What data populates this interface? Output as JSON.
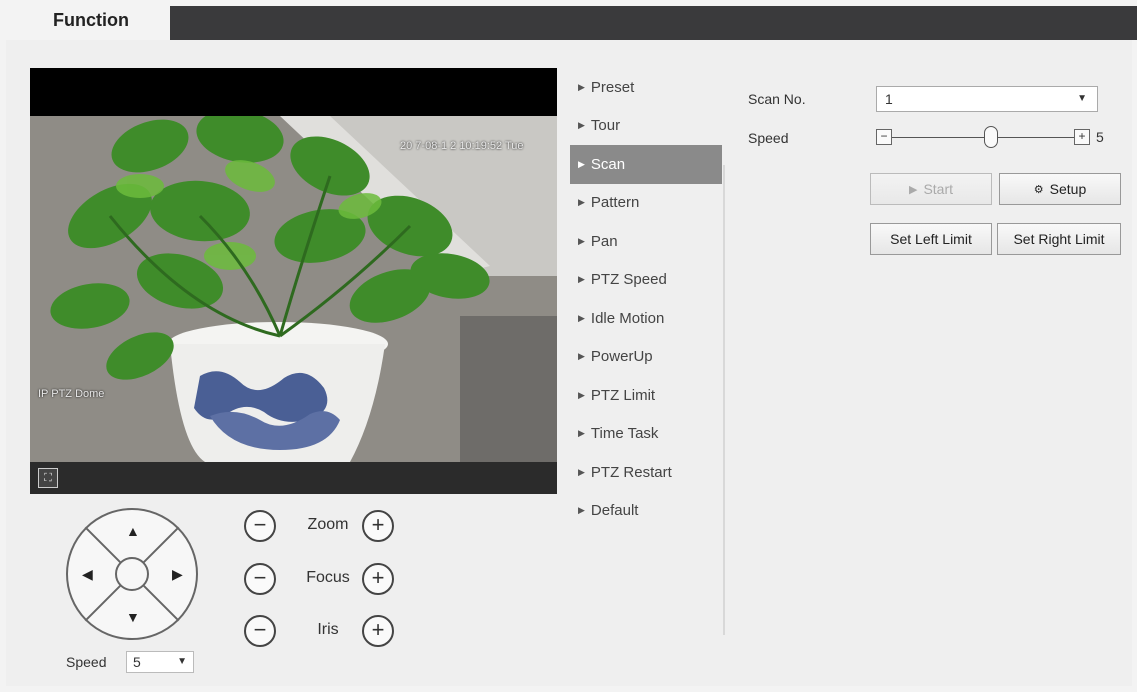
{
  "tab": {
    "label": "Function"
  },
  "video": {
    "timestamp": "20 7-08-1 2 10:19:52 Tue",
    "camera_name": "IP PTZ Dome",
    "fullscreen_icon": "fullscreen-icon"
  },
  "ptz": {
    "zoom_label": "Zoom",
    "focus_label": "Focus",
    "iris_label": "Iris",
    "speed_label": "Speed",
    "speed_value": "5"
  },
  "menu": {
    "items": [
      {
        "label": "Preset"
      },
      {
        "label": "Tour"
      },
      {
        "label": "Scan"
      },
      {
        "label": "Pattern"
      },
      {
        "label": "Pan"
      },
      {
        "label": "PTZ Speed"
      },
      {
        "label": "Idle Motion"
      },
      {
        "label": "PowerUp"
      },
      {
        "label": "PTZ Limit"
      },
      {
        "label": "Time Task"
      },
      {
        "label": "PTZ Restart"
      },
      {
        "label": "Default"
      }
    ],
    "active": "Scan"
  },
  "scan": {
    "scan_no_label": "Scan No.",
    "scan_no_value": "1",
    "speed_label": "Speed",
    "speed_value": "5",
    "speed_min_glyph": "−",
    "speed_plus_glyph": "+",
    "start_label": "Start",
    "setup_label": "Setup",
    "set_left_label": "Set Left Limit",
    "set_right_label": "Set Right Limit"
  }
}
